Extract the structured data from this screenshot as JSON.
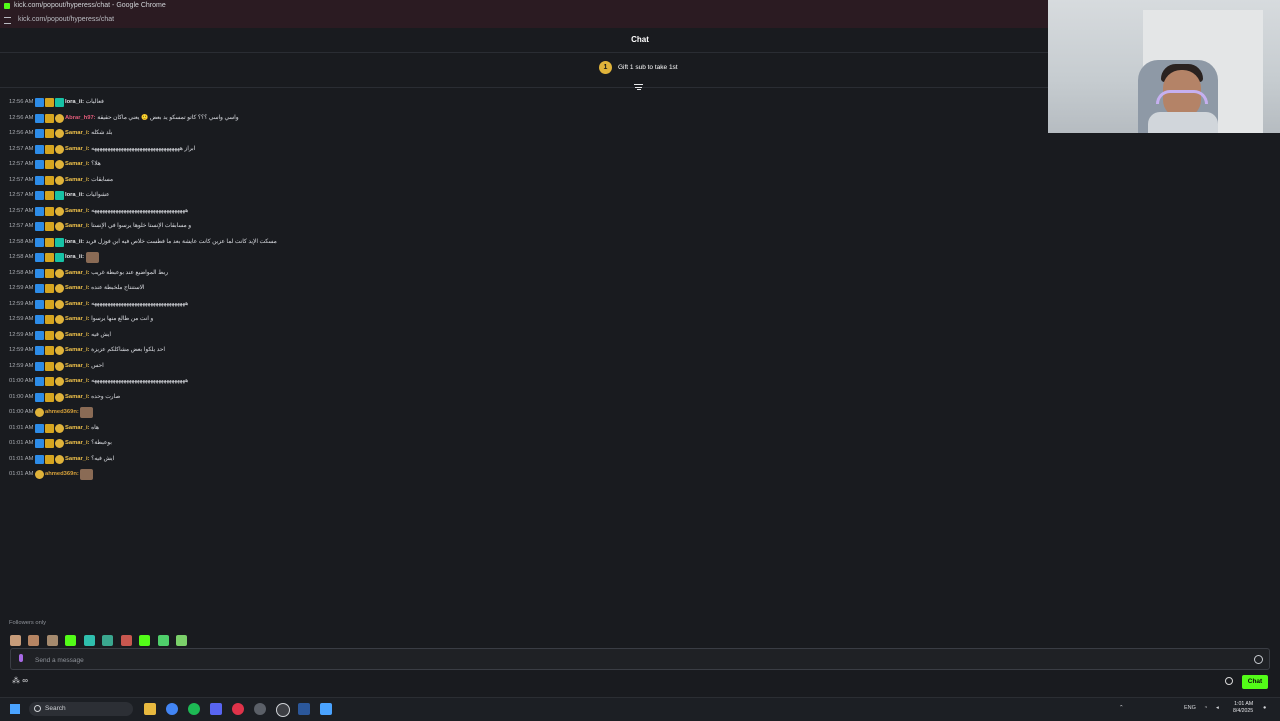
{
  "browser": {
    "window_title": "kick.com/popout/hyperess/chat - Google Chrome",
    "url": "kick.com/popout/hyperess/chat"
  },
  "chat": {
    "header": "Chat",
    "pinned": {
      "gift_number": "1",
      "text": "Gift 1 sub to take 1st"
    },
    "messages": [
      {
        "time": "12:56 AM",
        "user": "lora_ii:",
        "color": "#e6e7ea",
        "badges": [
          "mod",
          "crown",
          "vip"
        ],
        "text": "فعاليات"
      },
      {
        "time": "12:56 AM",
        "user": "Abrar_h97:",
        "color": "#e35c7a",
        "badges": [
          "mod",
          "crown",
          "sub"
        ],
        "text": "واسي واسي ؟؟؟ كاتو تمسكو يد بعض 🙂 يعني ماكان حقيقة"
      },
      {
        "time": "12:56 AM",
        "user": "Samar_i:",
        "color": "#f0c24a",
        "badges": [
          "mod",
          "crown",
          "sub"
        ],
        "text": "بلد شكله"
      },
      {
        "time": "12:57 AM",
        "user": "Samar_i:",
        "color": "#f0c24a",
        "badges": [
          "mod",
          "crown",
          "sub"
        ],
        "text": "ابراز هههههههههههههههههههههههههههههههههه"
      },
      {
        "time": "12:57 AM",
        "user": "Samar_i:",
        "color": "#f0c24a",
        "badges": [
          "mod",
          "crown",
          "sub"
        ],
        "text": "هلا؟"
      },
      {
        "time": "12:57 AM",
        "user": "Samar_i:",
        "color": "#f0c24a",
        "badges": [
          "mod",
          "crown",
          "sub"
        ],
        "text": "مسابقات"
      },
      {
        "time": "12:57 AM",
        "user": "lora_ii:",
        "color": "#e6e7ea",
        "badges": [
          "mod",
          "crown",
          "vip"
        ],
        "text": "عشوائيات"
      },
      {
        "time": "12:57 AM",
        "user": "Samar_i:",
        "color": "#f0c24a",
        "badges": [
          "mod",
          "crown",
          "sub"
        ],
        "text": "هههههههههههههههههههههههههههههههههههه"
      },
      {
        "time": "12:57 AM",
        "user": "Samar_i:",
        "color": "#f0c24a",
        "badges": [
          "mod",
          "crown",
          "sub"
        ],
        "text": "و مسابقات الإنستا خلوها يرسوا في الإنستا"
      },
      {
        "time": "12:58 AM",
        "user": "lora_ii:",
        "color": "#e6e7ea",
        "badges": [
          "mod",
          "crown",
          "vip"
        ],
        "text": "مسكت الإيد كانت لما عزين كانت عايشة بعد ما فطست خلاص فيه ابن فوزل فريد"
      },
      {
        "time": "12:58 AM",
        "user": "lora_ii:",
        "color": "#e6e7ea",
        "badges": [
          "mod",
          "crown",
          "vip"
        ],
        "text": "",
        "emote": true
      },
      {
        "time": "12:58 AM",
        "user": "Samar_i:",
        "color": "#f0c24a",
        "badges": [
          "mod",
          "crown",
          "sub"
        ],
        "text": "ربط المواضيع عند بوعبطة غريب"
      },
      {
        "time": "12:59 AM",
        "user": "Samar_i:",
        "color": "#f0c24a",
        "badges": [
          "mod",
          "crown",
          "sub"
        ],
        "text": "الاستنتاج ملخبطة عنده"
      },
      {
        "time": "12:59 AM",
        "user": "Samar_i:",
        "color": "#f0c24a",
        "badges": [
          "mod",
          "crown",
          "sub"
        ],
        "text": "هههههههههههههههههههههههههههههههههههه"
      },
      {
        "time": "12:59 AM",
        "user": "Samar_i:",
        "color": "#f0c24a",
        "badges": [
          "mod",
          "crown",
          "sub"
        ],
        "text": "و انت من طالع منها يرسوا"
      },
      {
        "time": "12:59 AM",
        "user": "Samar_i:",
        "color": "#f0c24a",
        "badges": [
          "mod",
          "crown",
          "sub"
        ],
        "text": "ايش فيه"
      },
      {
        "time": "12:59 AM",
        "user": "Samar_i:",
        "color": "#f0c24a",
        "badges": [
          "mod",
          "crown",
          "sub"
        ],
        "text": "احد يلكوا بعض مشاكلكم عزيزة"
      },
      {
        "time": "12:59 AM",
        "user": "Samar_i:",
        "color": "#f0c24a",
        "badges": [
          "mod",
          "crown",
          "sub"
        ],
        "text": "احس"
      },
      {
        "time": "01:00 AM",
        "user": "Samar_i:",
        "color": "#f0c24a",
        "badges": [
          "mod",
          "crown",
          "sub"
        ],
        "text": "هههههههههههههههههههههههههههههههههههه"
      },
      {
        "time": "01:00 AM",
        "user": "Samar_i:",
        "color": "#f0c24a",
        "badges": [
          "mod",
          "crown",
          "sub"
        ],
        "text": "صارت وحده"
      },
      {
        "time": "01:00 AM",
        "user": "ahmed369n:",
        "color": "#d8a23a",
        "badges": [
          "sub"
        ],
        "text": "",
        "emote": true
      },
      {
        "time": "01:01 AM",
        "user": "Samar_i:",
        "color": "#f0c24a",
        "badges": [
          "mod",
          "crown",
          "sub"
        ],
        "text": "هاه"
      },
      {
        "time": "01:01 AM",
        "user": "Samar_i:",
        "color": "#f0c24a",
        "badges": [
          "mod",
          "crown",
          "sub"
        ],
        "text": "بوعبطة؟"
      },
      {
        "time": "01:01 AM",
        "user": "Samar_i:",
        "color": "#f0c24a",
        "badges": [
          "mod",
          "crown",
          "sub"
        ],
        "text": "ايش فيه؟"
      },
      {
        "time": "01:01 AM",
        "user": "ahmed369n:",
        "color": "#d8a23a",
        "badges": [
          "sub"
        ],
        "text": "",
        "emote": true
      }
    ],
    "mode": "Followers only",
    "input_placeholder": "Send a message",
    "send_label": "Chat"
  },
  "taskbar": {
    "search_label": "Search",
    "language": "ENG",
    "time": "1:01 AM",
    "date": "8/4/2025"
  },
  "colors": {
    "accent": "#53fc18",
    "background": "#191b1f"
  }
}
